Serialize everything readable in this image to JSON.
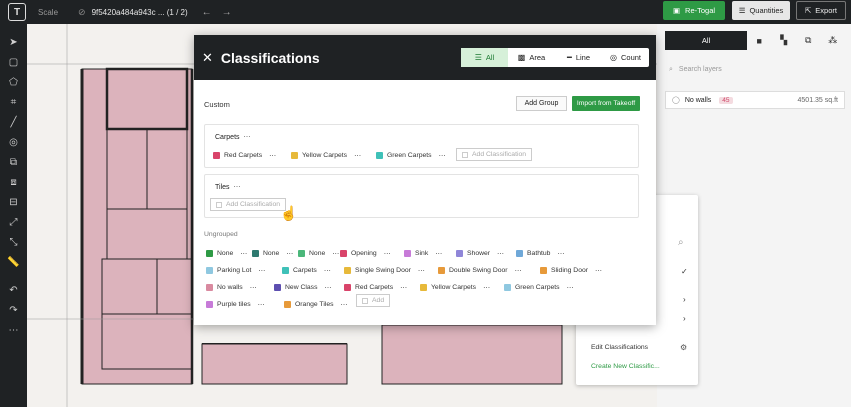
{
  "topbar": {
    "logo": "T",
    "scale_label": "Scale",
    "doc_title": "9f5420a484a943c ... (1 / 2)",
    "retogal_label": "Re-Togal",
    "quantities_label": "Quantities",
    "export_label": "Export",
    "colors": {
      "bar": "#1f2224",
      "accent": "#2e9a45"
    }
  },
  "rightpanel": {
    "seg_all": "All",
    "search_placeholder": "Search layers",
    "layer": {
      "name": "No walls",
      "count": "45",
      "area": "4501.35 sq.ft"
    }
  },
  "context_menu": {
    "edit": "Edit Classifications",
    "create": "Create New Classific..."
  },
  "modal": {
    "title": "Classifications",
    "filters": [
      {
        "label": "All",
        "icon": "list-icon",
        "active": true
      },
      {
        "label": "Area",
        "icon": "area-icon",
        "active": false
      },
      {
        "label": "Line",
        "icon": "line-icon",
        "active": false
      },
      {
        "label": "Count",
        "icon": "count-icon",
        "active": false
      }
    ],
    "custom_label": "Custom",
    "add_group": "Add Group",
    "import_takeoff": "Import from Takeoff",
    "groups": [
      {
        "title": "Carpets",
        "chips": [
          {
            "label": "Red Carpets",
            "color": "#d9446a"
          },
          {
            "label": "Yellow Carpets",
            "color": "#e7b93a"
          },
          {
            "label": "Green Carpets",
            "color": "#3fc1b8"
          }
        ],
        "add_label": "Add Classification"
      },
      {
        "title": "Tiles",
        "chips": [],
        "add_label": "Add Classification"
      }
    ],
    "ungrouped_label": "Ungrouped",
    "ungrouped": [
      {
        "label": "None",
        "color": "#2e9a45"
      },
      {
        "label": "None",
        "color": "#2e7a70"
      },
      {
        "label": "None",
        "color": "#4bb77a"
      },
      {
        "label": "Opening",
        "color": "#d9446a"
      },
      {
        "label": "Sink",
        "color": "#c77bd8"
      },
      {
        "label": "Shower",
        "color": "#8f86d8"
      },
      {
        "label": "Bathtub",
        "color": "#6fa8d8"
      },
      {
        "label": "Parking Lot",
        "color": "#8fc8e0"
      },
      {
        "label": "Carpets",
        "color": "#3fc1b8"
      },
      {
        "label": "Single Swing Door",
        "color": "#e7b93a"
      },
      {
        "label": "Double Swing Door",
        "color": "#e79a3a"
      },
      {
        "label": "Sliding Door",
        "color": "#e79a3a"
      },
      {
        "label": "No walls",
        "color": "#d98aa0"
      },
      {
        "label": "New Class",
        "color": "#5d4fb0"
      },
      {
        "label": "Red Carpets",
        "color": "#d9446a"
      },
      {
        "label": "Yellow Carpets",
        "color": "#e7b93a"
      },
      {
        "label": "Green Carpets",
        "color": "#8fc8e0"
      },
      {
        "label": "Purple tiles",
        "color": "#c77bd8"
      },
      {
        "label": "Orange Tiles",
        "color": "#e79a3a"
      }
    ],
    "ungrouped_add": "Add"
  }
}
